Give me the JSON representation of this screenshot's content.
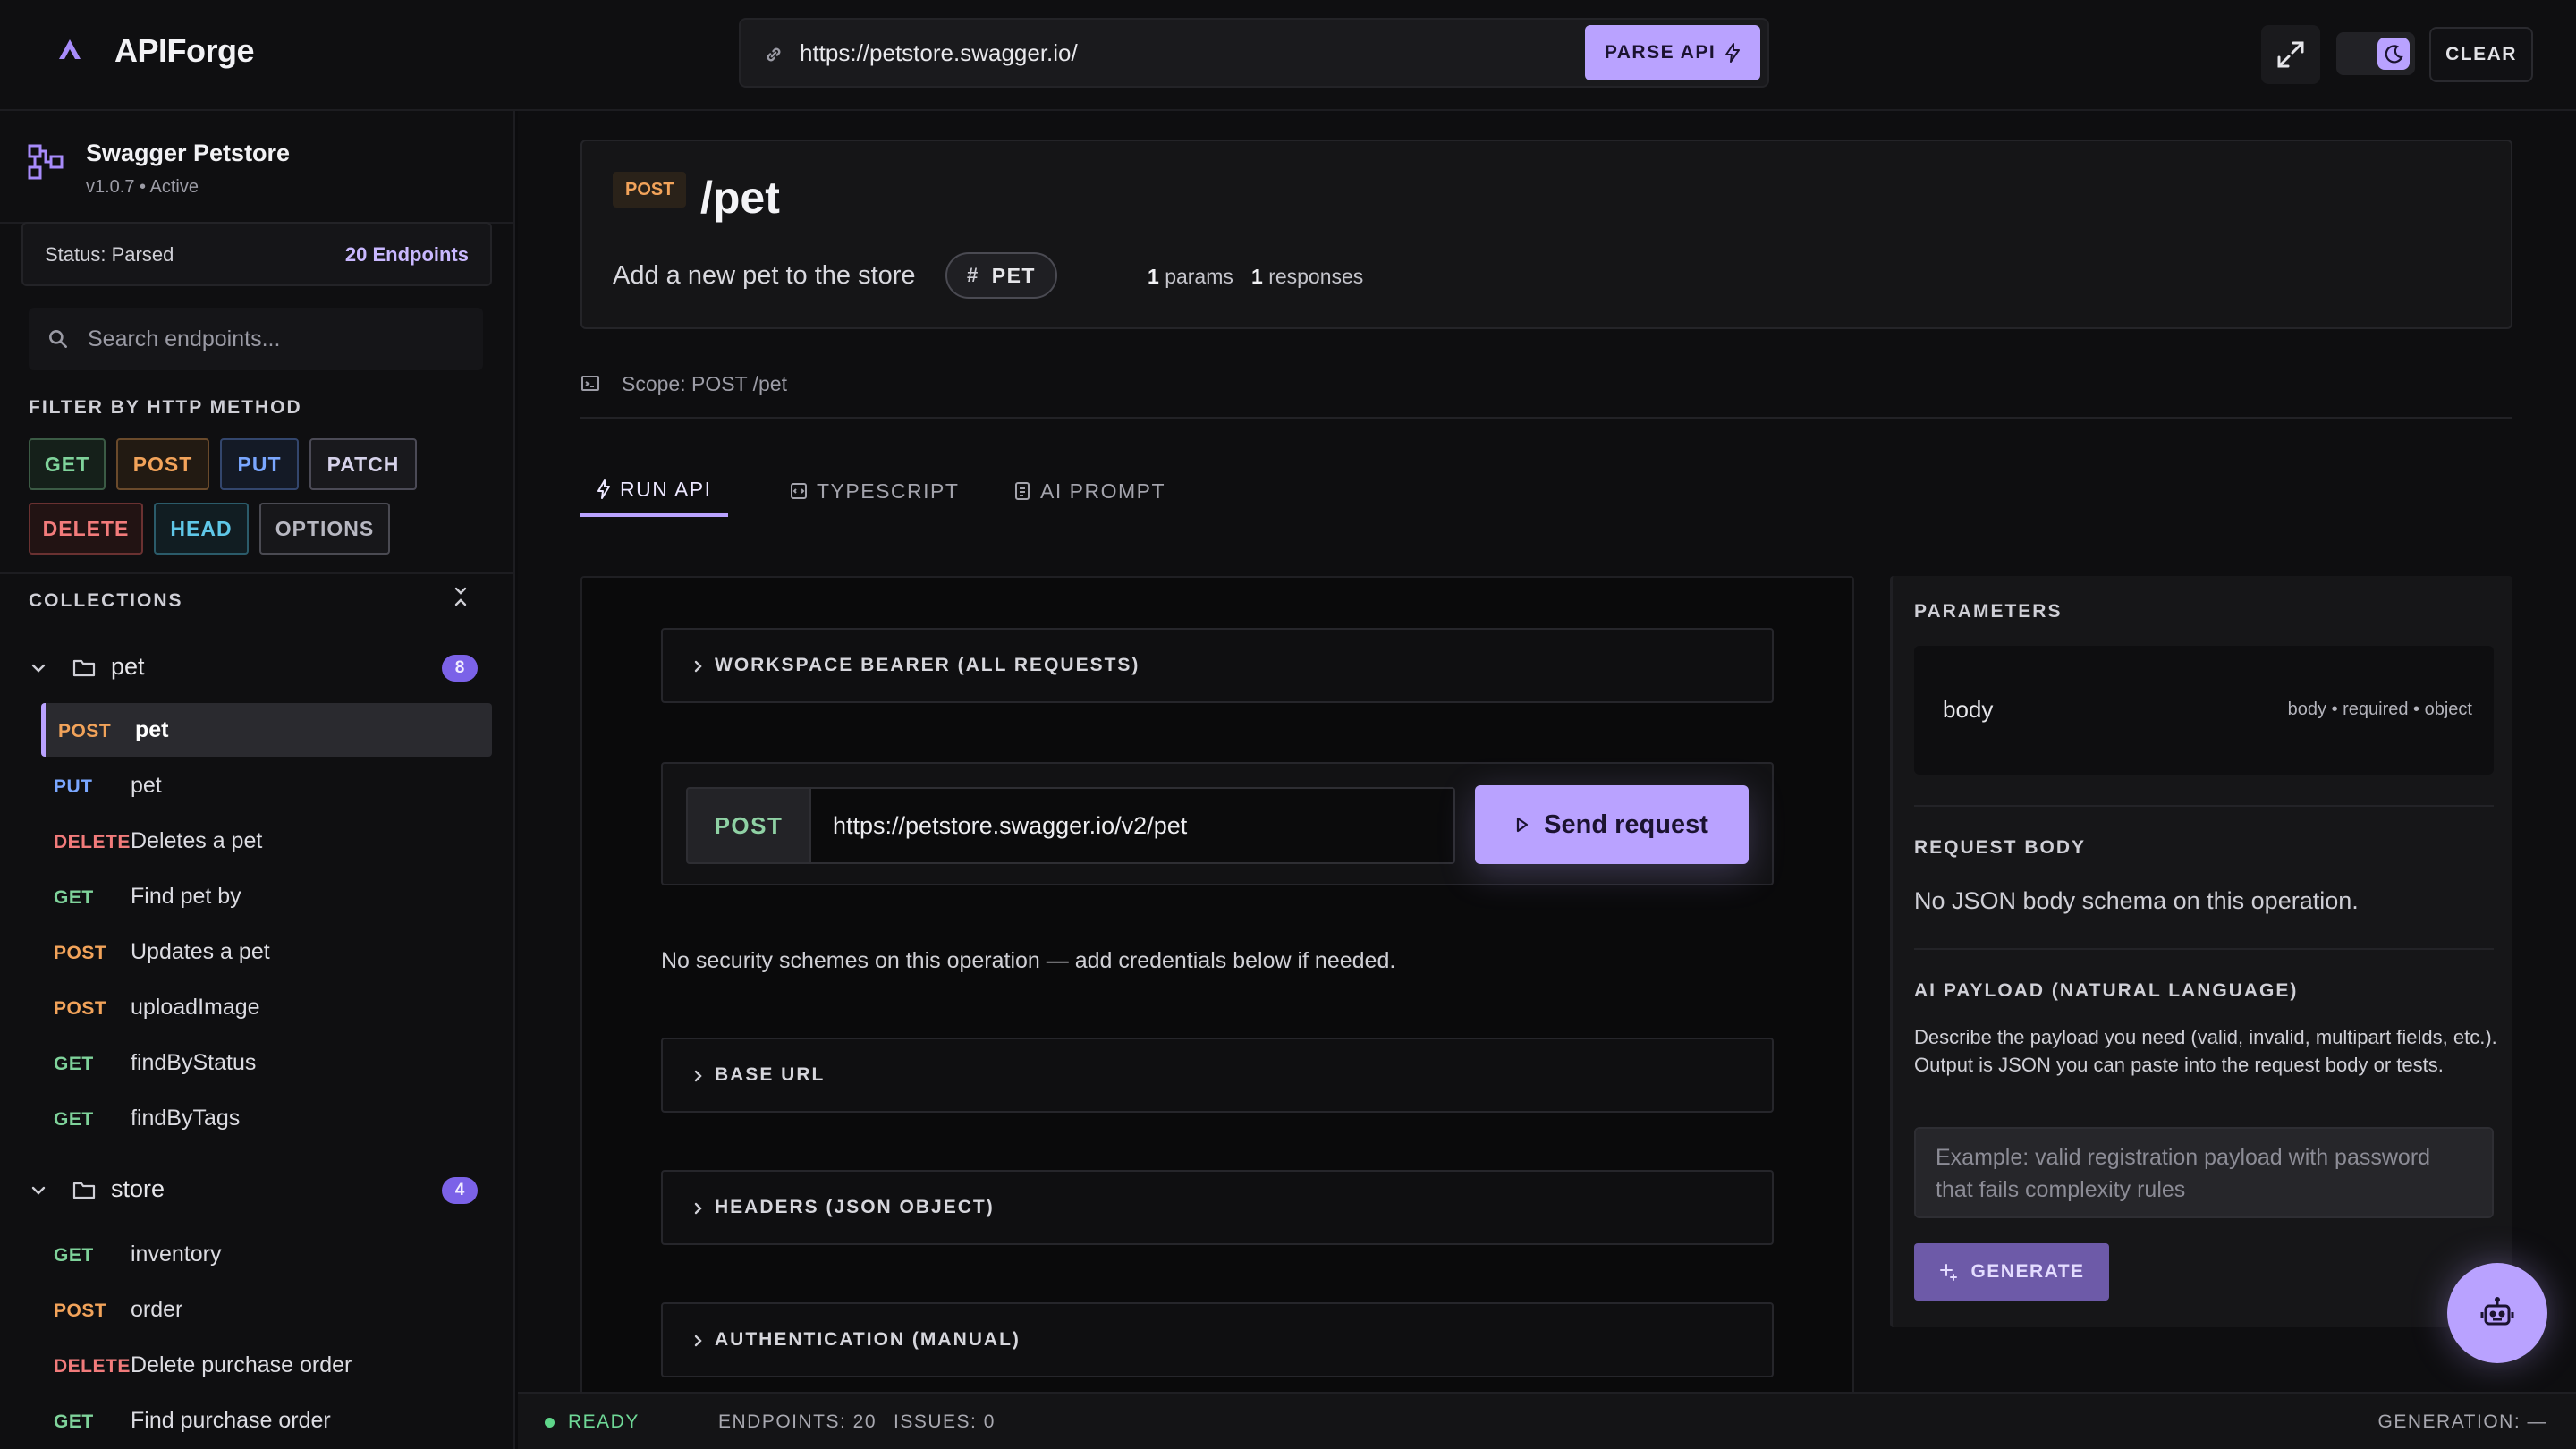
{
  "app": {
    "name": "APIForge"
  },
  "topbar": {
    "url_value": "https://petstore.swagger.io/",
    "parse_label": "PARSE API",
    "clear_label": "CLEAR"
  },
  "project": {
    "name": "Swagger Petstore",
    "meta": "v1.0.7 • Active",
    "status": "Status: Parsed",
    "endpoint_count": "20 Endpoints"
  },
  "search": {
    "placeholder": "Search endpoints..."
  },
  "filter": {
    "label": "FILTER BY HTTP METHOD",
    "methods": [
      "GET",
      "POST",
      "PUT",
      "PATCH",
      "DELETE",
      "HEAD",
      "OPTIONS"
    ]
  },
  "collections": {
    "label": "COLLECTIONS",
    "groups": [
      {
        "name": "pet",
        "count": "8",
        "items": [
          {
            "method": "POST",
            "name": "pet"
          },
          {
            "method": "PUT",
            "name": "pet"
          },
          {
            "method": "DELETE",
            "name": "Deletes a pet"
          },
          {
            "method": "GET",
            "name": "Find pet by"
          },
          {
            "method": "POST",
            "name": "Updates a pet"
          },
          {
            "method": "POST",
            "name": "uploadImage"
          },
          {
            "method": "GET",
            "name": "findByStatus"
          },
          {
            "method": "GET",
            "name": "findByTags"
          }
        ]
      },
      {
        "name": "store",
        "count": "4",
        "items": [
          {
            "method": "GET",
            "name": "inventory"
          },
          {
            "method": "POST",
            "name": "order"
          },
          {
            "method": "DELETE",
            "name": "Delete purchase order"
          },
          {
            "method": "GET",
            "name": "Find purchase order"
          }
        ]
      }
    ]
  },
  "endpoint": {
    "method": "POST",
    "path": "/pet",
    "description": "Add a new pet to the store",
    "tag": "PET",
    "params_count": "1",
    "params_label": "params",
    "responses_count": "1",
    "responses_label": "responses",
    "scope": "Scope: POST /pet"
  },
  "tabs": [
    "RUN API",
    "TYPESCRIPT",
    "AI PROMPT"
  ],
  "run": {
    "workspace_bearer": "WORKSPACE BEARER (ALL REQUESTS)",
    "method": "POST",
    "request_url": "https://petstore.swagger.io/v2/pet",
    "send_label": "Send request",
    "security_note": "No security schemes on this operation — add credentials below if needed.",
    "base_url": "BASE URL",
    "headers": "HEADERS (JSON OBJECT)",
    "auth": "AUTHENTICATION (MANUAL)"
  },
  "right": {
    "params_label": "PARAMETERS",
    "param_name": "body",
    "param_meta": "body • required • object",
    "body_label": "REQUEST BODY",
    "body_text": "No JSON body schema on this operation.",
    "ai_label": "AI PAYLOAD (NATURAL LANGUAGE)",
    "ai_help": "Describe the payload you need (valid, invalid, multipart fields, etc.). Output is JSON you can paste into the request body or tests.",
    "ai_placeholder": "Example: valid registration payload with password that fails complexity rules",
    "generate_label": "GENERATE"
  },
  "statusbar": {
    "ready": "READY",
    "endpoints": "ENDPOINTS: 20",
    "issues": "ISSUES: 0",
    "generation": "GENERATION: —"
  },
  "colors": {
    "accent": "#b9a2ff",
    "GET": "#7fd39b",
    "POST": "#f2a35a",
    "PUT": "#7aa7ff",
    "PATCH": "#c9c3e6",
    "DELETE": "#f27b7b",
    "HEAD": "#5fc7e8",
    "OPTIONS": "#b8b8c2"
  }
}
